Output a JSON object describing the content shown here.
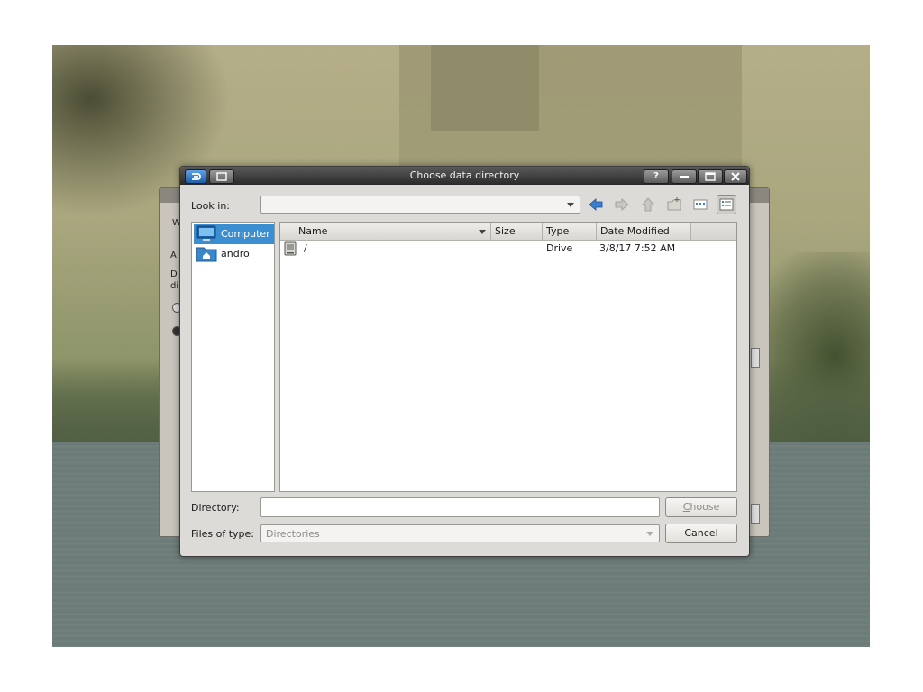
{
  "dialog": {
    "title": "Choose data directory"
  },
  "look_in": {
    "label": "Look in:",
    "value": ""
  },
  "sidebar": {
    "items": [
      {
        "label": "Computer",
        "icon": "computer-icon",
        "selected": true
      },
      {
        "label": "andro",
        "icon": "home-folder-icon",
        "selected": false
      }
    ]
  },
  "file_list": {
    "columns": [
      "Name",
      "Size",
      "Type",
      "Date Modified"
    ],
    "rows": [
      {
        "name": "/",
        "size": "",
        "type": "Drive",
        "date_modified": "3/8/17 7:52 AM",
        "icon": "drive-icon"
      }
    ]
  },
  "directory": {
    "label": "Directory:",
    "value": ""
  },
  "files_of_type": {
    "label": "Files of type:",
    "value": "Directories"
  },
  "buttons": {
    "choose_prefix": "",
    "choose_mnemonic": "C",
    "choose_rest": "hoose",
    "cancel": "Cancel"
  },
  "titlebar_buttons": {
    "help": "?"
  },
  "colors": {
    "selection": "#3b8fd1",
    "titlebar": "#2a2a2a",
    "dialog_bg": "#dddbd7"
  }
}
